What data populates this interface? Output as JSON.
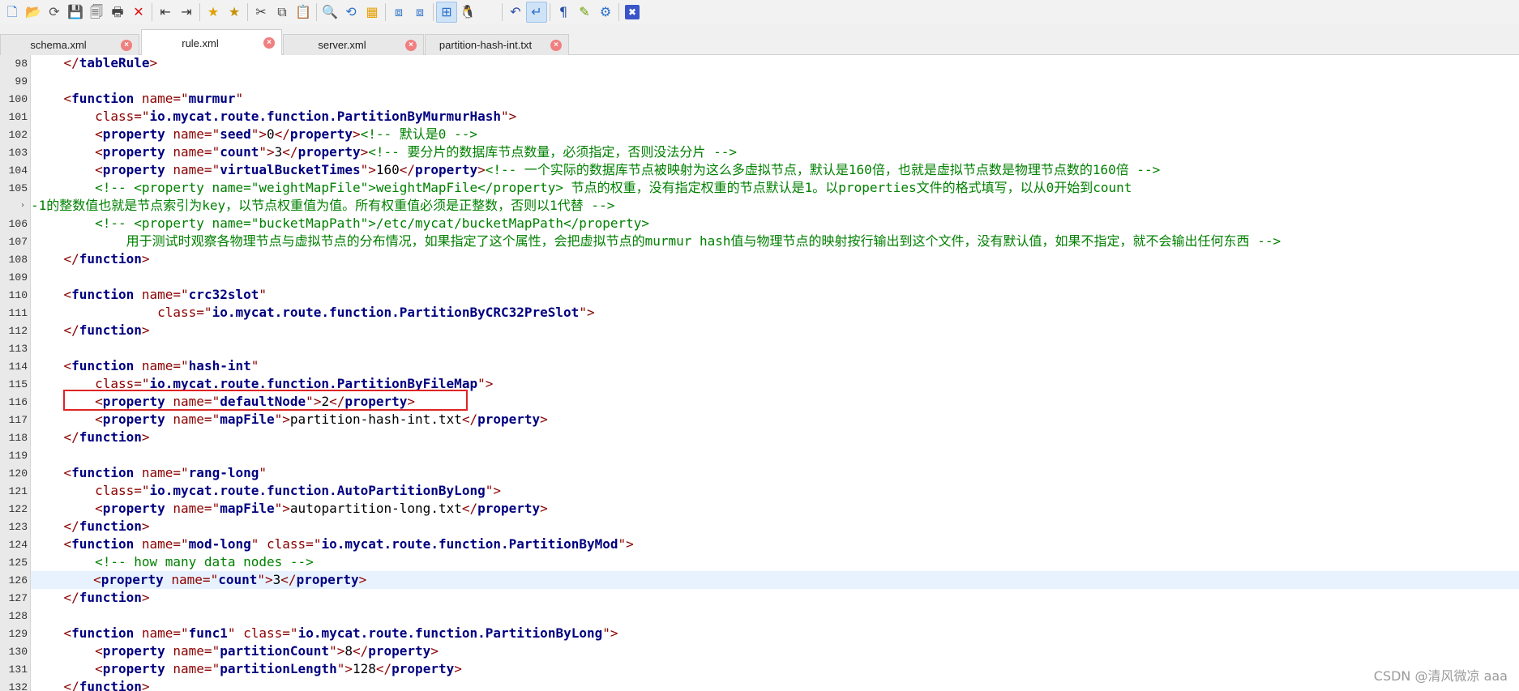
{
  "toolbar": {
    "buttons": [
      {
        "icon": "new-file-icon",
        "glyph": "🗋",
        "color": "#3a7bd5"
      },
      {
        "icon": "open-folder-icon",
        "glyph": "📂",
        "color": "#d9a400"
      },
      {
        "icon": "reload-icon",
        "glyph": "⟳",
        "color": "#555555"
      },
      {
        "icon": "save-icon",
        "glyph": "💾",
        "color": "#444444"
      },
      {
        "icon": "save-all-icon",
        "glyph": "🗐",
        "color": "#444444"
      },
      {
        "icon": "print-icon",
        "glyph": "🖶",
        "color": "#444444"
      },
      {
        "icon": "close-file-icon",
        "glyph": "✕",
        "color": "#e01010"
      },
      {
        "icon": "outdent-icon",
        "glyph": "⇤",
        "color": "#333333"
      },
      {
        "icon": "indent-icon",
        "glyph": "⇥",
        "color": "#333333"
      },
      {
        "icon": "bookmark-icon",
        "glyph": "★",
        "color": "#e0a000"
      },
      {
        "icon": "bookmark-next-icon",
        "glyph": "★",
        "color": "#c89000"
      },
      {
        "icon": "cut-icon",
        "glyph": "✂",
        "color": "#444444"
      },
      {
        "icon": "copy-icon",
        "glyph": "⧉",
        "color": "#444444"
      },
      {
        "icon": "paste-icon",
        "glyph": "📋",
        "color": "#444444"
      },
      {
        "icon": "find-icon",
        "glyph": "🔍",
        "color": "#2a6fc9"
      },
      {
        "icon": "replace-icon",
        "glyph": "⟲",
        "color": "#2a6fc9"
      },
      {
        "icon": "highlight-icon",
        "glyph": "▦",
        "color": "#e8a000"
      },
      {
        "icon": "compare-icon",
        "glyph": "⧈",
        "color": "#2a6fc9"
      },
      {
        "icon": "compare-folders-icon",
        "glyph": "⧈",
        "color": "#2a6fc9"
      },
      {
        "icon": "windows-icon",
        "glyph": "⊞",
        "color": "#2a6fc9",
        "active": true
      },
      {
        "icon": "linux-icon",
        "glyph": "🐧",
        "color": "#222222"
      },
      {
        "icon": "mac-icon",
        "glyph": "",
        "color": "#3b7dd8"
      },
      {
        "icon": "undo-icon",
        "glyph": "↶",
        "color": "#2a4fa8"
      },
      {
        "icon": "word-wrap-icon",
        "glyph": "↵",
        "color": "#2a6fc9",
        "active": true
      },
      {
        "icon": "paragraph-icon",
        "glyph": "¶",
        "color": "#2a4fa8"
      },
      {
        "icon": "pen-icon",
        "glyph": "✎",
        "color": "#6aa000"
      },
      {
        "icon": "settings-icon",
        "glyph": "⚙",
        "color": "#2a6fc9"
      },
      {
        "icon": "close-window-icon",
        "glyph": "✖",
        "color": "#ffffff",
        "bg": "#3a55c8"
      }
    ]
  },
  "tabs": [
    {
      "label": "schema.xml",
      "active": false
    },
    {
      "label": "rule.xml",
      "active": true
    },
    {
      "label": "server.xml",
      "active": false
    },
    {
      "label": "partition-hash-int.txt",
      "active": false
    }
  ],
  "editor": {
    "line_numbers": [
      "98",
      "99",
      "100",
      "101",
      "102",
      "103",
      "104",
      "105",
      "",
      "106",
      "107",
      "108",
      "109",
      "110",
      "111",
      "112",
      "113",
      "114",
      "115",
      "116",
      "117",
      "118",
      "119",
      "120",
      "121",
      "122",
      "123",
      "124",
      "125",
      "126",
      "127",
      "128",
      "129",
      "130",
      "131",
      "132"
    ],
    "lines": [
      [
        [
          "    ",
          "t"
        ],
        [
          "</",
          "b"
        ],
        [
          "tableRule",
          "g"
        ],
        [
          ">",
          "b"
        ]
      ],
      [],
      [
        [
          "    ",
          "t"
        ],
        [
          "<",
          "b"
        ],
        [
          "function",
          "g"
        ],
        [
          " name=",
          "a"
        ],
        [
          "\"",
          "q"
        ],
        [
          "murmur",
          "v"
        ],
        [
          "\"",
          "q"
        ]
      ],
      [
        [
          "        class=",
          "a"
        ],
        [
          "\"",
          "q"
        ],
        [
          "io.mycat.route.function.PartitionByMurmurHash",
          "v"
        ],
        [
          "\"",
          "q"
        ],
        [
          ">",
          "b"
        ]
      ],
      [
        [
          "        ",
          "t"
        ],
        [
          "<",
          "b"
        ],
        [
          "property",
          "g"
        ],
        [
          " name=",
          "a"
        ],
        [
          "\"",
          "q"
        ],
        [
          "seed",
          "v"
        ],
        [
          "\"",
          "q"
        ],
        [
          ">",
          "b"
        ],
        [
          "0",
          "t"
        ],
        [
          "</",
          "b"
        ],
        [
          "property",
          "g"
        ],
        [
          ">",
          "b"
        ],
        [
          "<!-- 默认是0 -->",
          "c"
        ]
      ],
      [
        [
          "        ",
          "t"
        ],
        [
          "<",
          "b"
        ],
        [
          "property",
          "g"
        ],
        [
          " name=",
          "a"
        ],
        [
          "\"",
          "q"
        ],
        [
          "count",
          "v"
        ],
        [
          "\"",
          "q"
        ],
        [
          ">",
          "b"
        ],
        [
          "3",
          "t"
        ],
        [
          "</",
          "b"
        ],
        [
          "property",
          "g"
        ],
        [
          ">",
          "b"
        ],
        [
          "<!-- 要分片的数据库节点数量，必须指定，否则没法分片 -->",
          "c"
        ]
      ],
      [
        [
          "        ",
          "t"
        ],
        [
          "<",
          "b"
        ],
        [
          "property",
          "g"
        ],
        [
          " name=",
          "a"
        ],
        [
          "\"",
          "q"
        ],
        [
          "virtualBucketTimes",
          "v"
        ],
        [
          "\"",
          "q"
        ],
        [
          ">",
          "b"
        ],
        [
          "160",
          "t"
        ],
        [
          "</",
          "b"
        ],
        [
          "property",
          "g"
        ],
        [
          ">",
          "b"
        ],
        [
          "<!-- 一个实际的数据库节点被映射为这么多虚拟节点，默认是160倍，也就是虚拟节点数是物理节点数的160倍 -->",
          "c"
        ]
      ],
      [
        [
          "        <!-- <property name=\"weightMapFile\">weightMapFile</property> 节点的权重，没有指定权重的节点默认是1。以properties文件的格式填写，以从0开始到count",
          "c"
        ]
      ],
      [
        [
          "-1的整数值也就是节点索引为key，以节点权重值为值。所有权重值必须是正整数，否则以1代替 -->",
          "c"
        ]
      ],
      [
        [
          "        <!-- <property name=\"bucketMapPath\">/etc/mycat/bucketMapPath</property>",
          "c"
        ]
      ],
      [
        [
          "            用于测试时观察各物理节点与虚拟节点的分布情况，如果指定了这个属性，会把虚拟节点的murmur hash值与物理节点的映射按行输出到这个文件，没有默认值，如果不指定，就不会输出任何东西 -->",
          "c"
        ]
      ],
      [
        [
          "    ",
          "t"
        ],
        [
          "</",
          "b"
        ],
        [
          "function",
          "g"
        ],
        [
          ">",
          "b"
        ]
      ],
      [],
      [
        [
          "    ",
          "t"
        ],
        [
          "<",
          "b"
        ],
        [
          "function",
          "g"
        ],
        [
          " name=",
          "a"
        ],
        [
          "\"",
          "q"
        ],
        [
          "crc32slot",
          "v"
        ],
        [
          "\"",
          "q"
        ]
      ],
      [
        [
          "                class=",
          "a"
        ],
        [
          "\"",
          "q"
        ],
        [
          "io.mycat.route.function.PartitionByCRC32PreSlot",
          "v"
        ],
        [
          "\"",
          "q"
        ],
        [
          ">",
          "b"
        ]
      ],
      [
        [
          "    ",
          "t"
        ],
        [
          "</",
          "b"
        ],
        [
          "function",
          "g"
        ],
        [
          ">",
          "b"
        ]
      ],
      [],
      [
        [
          "    ",
          "t"
        ],
        [
          "<",
          "b"
        ],
        [
          "function",
          "g"
        ],
        [
          " name=",
          "a"
        ],
        [
          "\"",
          "q"
        ],
        [
          "hash-int",
          "v"
        ],
        [
          "\"",
          "q"
        ]
      ],
      [
        [
          "        class=",
          "a"
        ],
        [
          "\"",
          "q"
        ],
        [
          "io.mycat.route.function.PartitionByFileMap",
          "v"
        ],
        [
          "\"",
          "q"
        ],
        [
          ">",
          "b"
        ]
      ],
      [
        [
          "        ",
          "t"
        ],
        [
          "<",
          "b"
        ],
        [
          "property",
          "g"
        ],
        [
          " name=",
          "a"
        ],
        [
          "\"",
          "q"
        ],
        [
          "defaultNode",
          "v"
        ],
        [
          "\"",
          "q"
        ],
        [
          ">",
          "b"
        ],
        [
          "2",
          "t"
        ],
        [
          "</",
          "b"
        ],
        [
          "property",
          "g"
        ],
        [
          ">",
          "b"
        ]
      ],
      [
        [
          "        ",
          "t"
        ],
        [
          "<",
          "b"
        ],
        [
          "property",
          "g"
        ],
        [
          " name=",
          "a"
        ],
        [
          "\"",
          "q"
        ],
        [
          "mapFile",
          "v"
        ],
        [
          "\"",
          "q"
        ],
        [
          ">",
          "b"
        ],
        [
          "partition-hash-int.txt",
          "t"
        ],
        [
          "</",
          "b"
        ],
        [
          "property",
          "g"
        ],
        [
          ">",
          "b"
        ]
      ],
      [
        [
          "    ",
          "t"
        ],
        [
          "</",
          "b"
        ],
        [
          "function",
          "g"
        ],
        [
          ">",
          "b"
        ]
      ],
      [],
      [
        [
          "    ",
          "t"
        ],
        [
          "<",
          "b"
        ],
        [
          "function",
          "g"
        ],
        [
          " name=",
          "a"
        ],
        [
          "\"",
          "q"
        ],
        [
          "rang-long",
          "v"
        ],
        [
          "\"",
          "q"
        ]
      ],
      [
        [
          "        class=",
          "a"
        ],
        [
          "\"",
          "q"
        ],
        [
          "io.mycat.route.function.AutoPartitionByLong",
          "v"
        ],
        [
          "\"",
          "q"
        ],
        [
          ">",
          "b"
        ]
      ],
      [
        [
          "        ",
          "t"
        ],
        [
          "<",
          "b"
        ],
        [
          "property",
          "g"
        ],
        [
          " name=",
          "a"
        ],
        [
          "\"",
          "q"
        ],
        [
          "mapFile",
          "v"
        ],
        [
          "\"",
          "q"
        ],
        [
          ">",
          "b"
        ],
        [
          "autopartition-long.txt",
          "t"
        ],
        [
          "</",
          "b"
        ],
        [
          "property",
          "g"
        ],
        [
          ">",
          "b"
        ]
      ],
      [
        [
          "    ",
          "t"
        ],
        [
          "</",
          "b"
        ],
        [
          "function",
          "g"
        ],
        [
          ">",
          "b"
        ]
      ],
      [
        [
          "    ",
          "t"
        ],
        [
          "<",
          "b"
        ],
        [
          "function",
          "g"
        ],
        [
          " name=",
          "a"
        ],
        [
          "\"",
          "q"
        ],
        [
          "mod-long",
          "v"
        ],
        [
          "\"",
          "q"
        ],
        [
          " class=",
          "a"
        ],
        [
          "\"",
          "q"
        ],
        [
          "io.mycat.route.function.PartitionByMod",
          "v"
        ],
        [
          "\"",
          "q"
        ],
        [
          ">",
          "b"
        ]
      ],
      [
        [
          "        <!-- how many data nodes -->",
          "c"
        ]
      ],
      [
        [
          "        ",
          "t"
        ],
        [
          "<",
          "b"
        ],
        [
          "property",
          "g"
        ],
        [
          " name=",
          "a"
        ],
        [
          "\"",
          "q"
        ],
        [
          "count",
          "v"
        ],
        [
          "\"",
          "q"
        ],
        [
          ">",
          "b"
        ],
        [
          "3",
          "t"
        ],
        [
          "</",
          "b"
        ],
        [
          "property",
          "g"
        ],
        [
          ">",
          "b"
        ]
      ],
      [
        [
          "    ",
          "t"
        ],
        [
          "</",
          "b"
        ],
        [
          "function",
          "g"
        ],
        [
          ">",
          "b"
        ]
      ],
      [],
      [
        [
          "    ",
          "t"
        ],
        [
          "<",
          "b"
        ],
        [
          "function",
          "g"
        ],
        [
          " name=",
          "a"
        ],
        [
          "\"",
          "q"
        ],
        [
          "func1",
          "v"
        ],
        [
          "\"",
          "q"
        ],
        [
          " class=",
          "a"
        ],
        [
          "\"",
          "q"
        ],
        [
          "io.mycat.route.function.PartitionByLong",
          "v"
        ],
        [
          "\"",
          "q"
        ],
        [
          ">",
          "b"
        ]
      ],
      [
        [
          "        ",
          "t"
        ],
        [
          "<",
          "b"
        ],
        [
          "property",
          "g"
        ],
        [
          " name=",
          "a"
        ],
        [
          "\"",
          "q"
        ],
        [
          "partitionCount",
          "v"
        ],
        [
          "\"",
          "q"
        ],
        [
          ">",
          "b"
        ],
        [
          "8",
          "t"
        ],
        [
          "</",
          "b"
        ],
        [
          "property",
          "g"
        ],
        [
          ">",
          "b"
        ]
      ],
      [
        [
          "        ",
          "t"
        ],
        [
          "<",
          "b"
        ],
        [
          "property",
          "g"
        ],
        [
          " name=",
          "a"
        ],
        [
          "\"",
          "q"
        ],
        [
          "partitionLength",
          "v"
        ],
        [
          "\"",
          "q"
        ],
        [
          ">",
          "b"
        ],
        [
          "128",
          "t"
        ],
        [
          "</",
          "b"
        ],
        [
          "property",
          "g"
        ],
        [
          ">",
          "b"
        ]
      ],
      [
        [
          "    ",
          "t"
        ],
        [
          "</",
          "b"
        ],
        [
          "function",
          "g"
        ],
        [
          ">",
          "b"
        ]
      ]
    ],
    "current_line": 29
  },
  "watermark": "CSDN @清风微凉 aaa"
}
